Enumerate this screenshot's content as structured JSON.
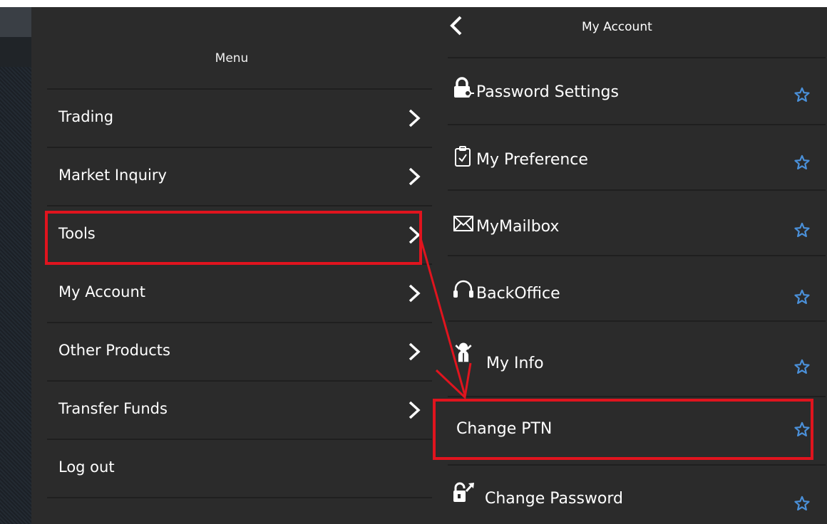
{
  "menu": {
    "title": "Menu",
    "items": [
      {
        "label": "Trading"
      },
      {
        "label": "Market Inquiry"
      },
      {
        "label": "Tools"
      },
      {
        "label": "My Account"
      },
      {
        "label": "Other Products"
      },
      {
        "label": "Transfer Funds"
      },
      {
        "label": "Log out"
      }
    ]
  },
  "account": {
    "title": "My Account",
    "items": [
      {
        "label": "Password Settings",
        "icon": "lock-key-icon"
      },
      {
        "label": "My Preference",
        "icon": "clipboard-check-icon"
      },
      {
        "label": "MyMailbox",
        "icon": "envelope-icon"
      },
      {
        "label": "BackOffice",
        "icon": "headset-icon"
      },
      {
        "label": "My Info",
        "icon": "person-icon"
      },
      {
        "label": "Change PTN",
        "icon": ""
      },
      {
        "label": "Change Password",
        "icon": "lock-arrow-icon"
      }
    ]
  },
  "colors": {
    "panel": "#2b2b2b",
    "text": "#ffffff",
    "star": "#4a90d9",
    "annotation": "#e0141e"
  }
}
